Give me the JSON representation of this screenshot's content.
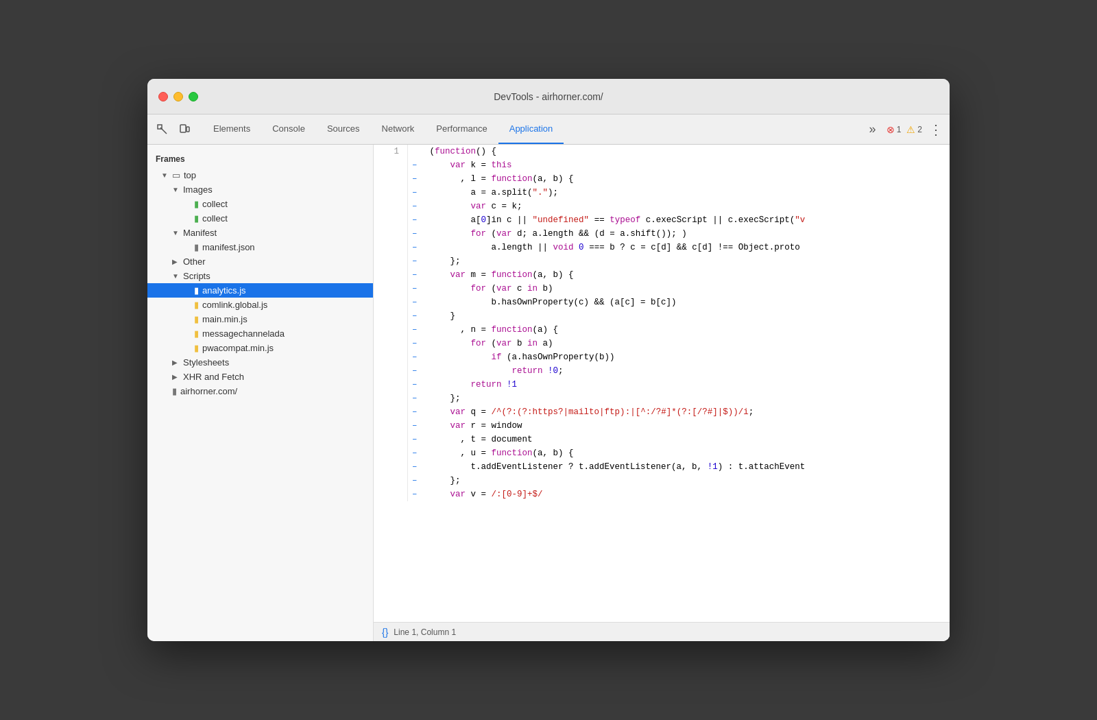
{
  "window": {
    "title": "DevTools - airhorner.com/"
  },
  "tabs": [
    {
      "label": "Elements",
      "active": false
    },
    {
      "label": "Console",
      "active": false
    },
    {
      "label": "Sources",
      "active": false
    },
    {
      "label": "Network",
      "active": false
    },
    {
      "label": "Performance",
      "active": false
    },
    {
      "label": "Application",
      "active": true
    }
  ],
  "toolbar": {
    "more_label": "»",
    "errors": "1",
    "warnings": "2"
  },
  "sidebar": {
    "section_label": "Frames",
    "items": [
      {
        "id": "top",
        "label": "top",
        "indent": 1,
        "type": "folder",
        "expanded": true,
        "icon": "folder"
      },
      {
        "id": "images",
        "label": "Images",
        "indent": 2,
        "type": "folder",
        "expanded": true,
        "icon": "folder"
      },
      {
        "id": "collect1",
        "label": "collect",
        "indent": 3,
        "type": "file-green",
        "icon": "file"
      },
      {
        "id": "collect2",
        "label": "collect",
        "indent": 3,
        "type": "file-green",
        "icon": "file"
      },
      {
        "id": "manifest",
        "label": "Manifest",
        "indent": 2,
        "type": "folder",
        "expanded": true,
        "icon": "folder"
      },
      {
        "id": "manifest-json",
        "label": "manifest.json",
        "indent": 3,
        "type": "file-gray",
        "icon": "file"
      },
      {
        "id": "other",
        "label": "Other",
        "indent": 2,
        "type": "folder",
        "expanded": false,
        "icon": "folder"
      },
      {
        "id": "scripts",
        "label": "Scripts",
        "indent": 2,
        "type": "folder",
        "expanded": true,
        "icon": "folder"
      },
      {
        "id": "analytics",
        "label": "analytics.js",
        "indent": 3,
        "type": "file-green",
        "icon": "file",
        "selected": true
      },
      {
        "id": "comlink",
        "label": "comlink.global.js",
        "indent": 3,
        "type": "file-yellow",
        "icon": "file"
      },
      {
        "id": "main",
        "label": "main.min.js",
        "indent": 3,
        "type": "file-yellow",
        "icon": "file"
      },
      {
        "id": "messagechannel",
        "label": "messagechanneladа",
        "indent": 3,
        "type": "file-yellow",
        "icon": "file"
      },
      {
        "id": "pwacompat",
        "label": "pwacompat.min.js",
        "indent": 3,
        "type": "file-yellow",
        "icon": "file"
      },
      {
        "id": "stylesheets",
        "label": "Stylesheets",
        "indent": 2,
        "type": "folder",
        "expanded": false,
        "icon": "folder"
      },
      {
        "id": "xhr",
        "label": "XHR and Fetch",
        "indent": 2,
        "type": "folder",
        "expanded": false,
        "icon": "folder"
      },
      {
        "id": "airhorner",
        "label": "airhorner.com/",
        "indent": 1,
        "type": "file-gray",
        "icon": "file"
      }
    ]
  },
  "code": {
    "lines": [
      {
        "num": 1,
        "gutter": "",
        "content": "(function() {"
      },
      {
        "num": "",
        "gutter": "–",
        "content": "    var k = this"
      },
      {
        "num": "",
        "gutter": "–",
        "content": "      , l = function(a, b) {"
      },
      {
        "num": "",
        "gutter": "–",
        "content": "        a = a.split(\".\");"
      },
      {
        "num": "",
        "gutter": "–",
        "content": "        var c = k;"
      },
      {
        "num": "",
        "gutter": "–",
        "content": "        a[0]in c || \"undefined\" == typeof c.execScript || c.execScript(\"v"
      },
      {
        "num": "",
        "gutter": "–",
        "content": "        for (var d; a.length && (d = a.shift()); )"
      },
      {
        "num": "",
        "gutter": "–",
        "content": "            a.length || void 0 === b ? c = c[d] && c[d] !== Object.proto"
      },
      {
        "num": "",
        "gutter": "–",
        "content": "    };"
      },
      {
        "num": "",
        "gutter": "–",
        "content": "    var m = function(a, b) {"
      },
      {
        "num": "",
        "gutter": "–",
        "content": "        for (var c in b)"
      },
      {
        "num": "",
        "gutter": "–",
        "content": "            b.hasOwnProperty(c) && (a[c] = b[c])"
      },
      {
        "num": "",
        "gutter": "–",
        "content": "    }"
      },
      {
        "num": "",
        "gutter": "–",
        "content": "      , n = function(a) {"
      },
      {
        "num": "",
        "gutter": "–",
        "content": "        for (var b in a)"
      },
      {
        "num": "",
        "gutter": "–",
        "content": "            if (a.hasOwnProperty(b))"
      },
      {
        "num": "",
        "gutter": "–",
        "content": "                return !0;"
      },
      {
        "num": "",
        "gutter": "–",
        "content": "        return !1"
      },
      {
        "num": "",
        "gutter": "–",
        "content": "    };"
      },
      {
        "num": "",
        "gutter": "–",
        "content": "    var q = /^(?:(?:https?|mailto|ftp):|[^:/?#]*(?:[/?#]|$))/i;"
      },
      {
        "num": "",
        "gutter": "–",
        "content": "    var r = window"
      },
      {
        "num": "",
        "gutter": "–",
        "content": "      , t = document"
      },
      {
        "num": "",
        "gutter": "–",
        "content": "      , u = function(a, b) {"
      },
      {
        "num": "",
        "gutter": "–",
        "content": "        t.addEventListener ? t.addEventListener(a, b, !1) : t.attachEvent"
      },
      {
        "num": "",
        "gutter": "–",
        "content": "    };"
      },
      {
        "num": "",
        "gutter": "–",
        "content": "    var v = /:[0-9]+$/"
      }
    ]
  },
  "status_bar": {
    "icon": "{}",
    "text": "Line 1, Column 1"
  }
}
